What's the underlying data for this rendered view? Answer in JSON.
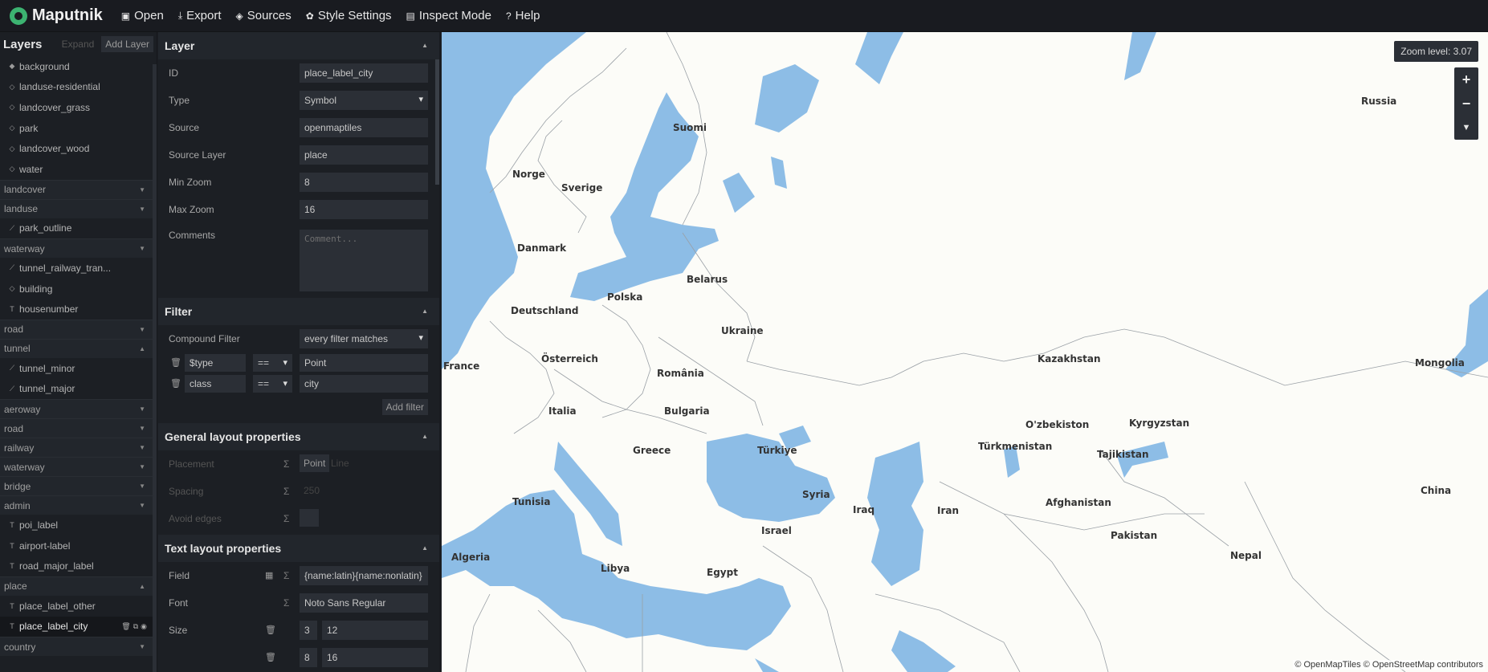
{
  "app": {
    "name": "Maputnik",
    "menu": [
      {
        "label": "Open",
        "icon": "open-icon"
      },
      {
        "label": "Export",
        "icon": "download-icon"
      },
      {
        "label": "Sources",
        "icon": "layers-icon"
      },
      {
        "label": "Style Settings",
        "icon": "gear-icon"
      },
      {
        "label": "Inspect Mode",
        "icon": "inspect-icon"
      },
      {
        "label": "Help",
        "icon": "help-icon"
      }
    ]
  },
  "layers_panel": {
    "title": "Layers",
    "expand_label": "Expand",
    "add_label": "Add Layer",
    "items": [
      {
        "kind": "layer",
        "label": "background",
        "icon": "background-icon"
      },
      {
        "kind": "layer",
        "label": "landuse-residential",
        "icon": "fill-icon"
      },
      {
        "kind": "layer",
        "label": "landcover_grass",
        "icon": "fill-icon"
      },
      {
        "kind": "layer",
        "label": "park",
        "icon": "fill-icon"
      },
      {
        "kind": "layer",
        "label": "landcover_wood",
        "icon": "fill-icon"
      },
      {
        "kind": "layer",
        "label": "water",
        "icon": "fill-icon"
      },
      {
        "kind": "group",
        "label": "landcover",
        "expanded": false
      },
      {
        "kind": "group",
        "label": "landuse",
        "expanded": false
      },
      {
        "kind": "layer",
        "label": "park_outline",
        "icon": "line-icon"
      },
      {
        "kind": "group",
        "label": "waterway",
        "expanded": false
      },
      {
        "kind": "layer",
        "label": "tunnel_railway_tran...",
        "icon": "line-icon"
      },
      {
        "kind": "layer",
        "label": "building",
        "icon": "fill-icon"
      },
      {
        "kind": "layer",
        "label": "housenumber",
        "icon": "symbol-icon"
      },
      {
        "kind": "group",
        "label": "road",
        "expanded": false
      },
      {
        "kind": "group",
        "label": "tunnel",
        "expanded": true
      },
      {
        "kind": "layer",
        "label": "tunnel_minor",
        "icon": "line-icon"
      },
      {
        "kind": "layer",
        "label": "tunnel_major",
        "icon": "line-icon"
      },
      {
        "kind": "group",
        "label": "aeroway",
        "expanded": false
      },
      {
        "kind": "group",
        "label": "road",
        "expanded": false
      },
      {
        "kind": "group",
        "label": "railway",
        "expanded": false
      },
      {
        "kind": "group",
        "label": "waterway",
        "expanded": false
      },
      {
        "kind": "group",
        "label": "bridge",
        "expanded": false
      },
      {
        "kind": "group",
        "label": "admin",
        "expanded": false
      },
      {
        "kind": "layer",
        "label": "poi_label",
        "icon": "symbol-icon"
      },
      {
        "kind": "layer",
        "label": "airport-label",
        "icon": "symbol-icon"
      },
      {
        "kind": "layer",
        "label": "road_major_label",
        "icon": "symbol-icon"
      },
      {
        "kind": "group",
        "label": "place",
        "expanded": true
      },
      {
        "kind": "layer",
        "label": "place_label_other",
        "icon": "symbol-icon"
      },
      {
        "kind": "layer",
        "label": "place_label_city",
        "icon": "symbol-icon",
        "selected": true
      },
      {
        "kind": "group",
        "label": "country",
        "expanded": false
      }
    ]
  },
  "editor": {
    "layer_section": {
      "title": "Layer",
      "fields": [
        {
          "label": "ID",
          "value": "place_label_city",
          "type": "input"
        },
        {
          "label": "Type",
          "value": "Symbol",
          "type": "select"
        },
        {
          "label": "Source",
          "value": "openmaptiles",
          "type": "input"
        },
        {
          "label": "Source Layer",
          "value": "place",
          "type": "input"
        },
        {
          "label": "Min Zoom",
          "value": "8",
          "type": "input"
        },
        {
          "label": "Max Zoom",
          "value": "16",
          "type": "input"
        }
      ],
      "comments_label": "Comments",
      "comments_placeholder": "Comment..."
    },
    "filter_section": {
      "title": "Filter",
      "compound_label": "Compound Filter",
      "compound_value": "every filter matches",
      "filters": [
        {
          "key": "$type",
          "op": "==",
          "value": "Point"
        },
        {
          "key": "class",
          "op": "==",
          "value": "city"
        }
      ],
      "add_label": "Add filter"
    },
    "general_layout": {
      "title": "General layout properties",
      "placement_label": "Placement",
      "placement_options": [
        "Point",
        "Line"
      ],
      "placement_selected": "Point",
      "spacing_label": "Spacing",
      "spacing_value": "250",
      "avoid_edges_label": "Avoid edges"
    },
    "text_layout": {
      "title": "Text layout properties",
      "field_label": "Field",
      "field_value": "{name:latin}{name:nonlatin}",
      "font_label": "Font",
      "font_value": "Noto Sans Regular",
      "size_label": "Size",
      "size_zoom": "3",
      "size_value": "12",
      "next_zoom": "8",
      "next_value": "16"
    }
  },
  "map": {
    "zoom_label": "Zoom level: 3.07",
    "attribution": "© OpenMapTiles © OpenStreetMap contributors",
    "water_color": "#8dbde6",
    "land_color": "#fcfcf8",
    "places": [
      "Russia",
      "Suomi",
      "Norge",
      "Sverige",
      "Danmark",
      "Belarus",
      "Polska",
      "Deutschland",
      "Ukraine",
      "France",
      "Österreich",
      "România",
      "Kazakhstan",
      "Mongolia",
      "Italia",
      "Bulgaria",
      "O'zbekiston",
      "Kyrgyzstan",
      "Greece",
      "Türkiye",
      "Türkmenistan",
      "Tajikistan",
      "Tunisia",
      "Syria",
      "Iraq",
      "Iran",
      "Afghanistan",
      "China",
      "Israel",
      "Pakistan",
      "Algeria",
      "Libya",
      "Egypt",
      "Nepal"
    ]
  }
}
